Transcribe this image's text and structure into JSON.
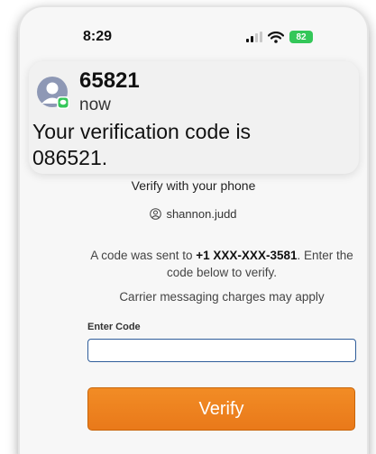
{
  "status_bar": {
    "time": "8:29",
    "battery": "82"
  },
  "notification": {
    "sender": "65821",
    "time": "now",
    "body": "Your verification code is 086521."
  },
  "page": {
    "title": "Verify with your phone",
    "username": "shannon.judd",
    "message_prefix": "A code was sent to ",
    "phone_number": "+1 XXX-XXX-3581",
    "message_suffix": ". Enter the code below to verify.",
    "charges_note": "Carrier messaging charges may apply",
    "code_label": "Enter Code",
    "code_value": "",
    "verify_label": "Verify"
  },
  "colors": {
    "accent": "#f28c25",
    "input_border": "#2f5d9a",
    "battery": "#34c759"
  }
}
